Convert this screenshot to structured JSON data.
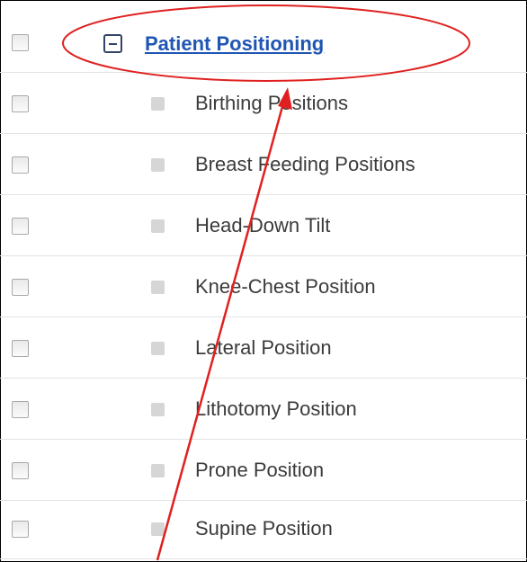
{
  "tree": {
    "parent": {
      "label": "Patient Positioning",
      "expanded": true
    },
    "children": [
      {
        "label": "Birthing Positions"
      },
      {
        "label": "Breast Feeding Positions"
      },
      {
        "label": "Head-Down Tilt"
      },
      {
        "label": "Knee-Chest Position"
      },
      {
        "label": "Lateral Position"
      },
      {
        "label": "Lithotomy Position"
      },
      {
        "label": "Prone Position"
      },
      {
        "label": "Supine Position"
      }
    ]
  },
  "annotation": {
    "color": "#e02020",
    "shapes": [
      "ellipse",
      "arrow"
    ]
  }
}
